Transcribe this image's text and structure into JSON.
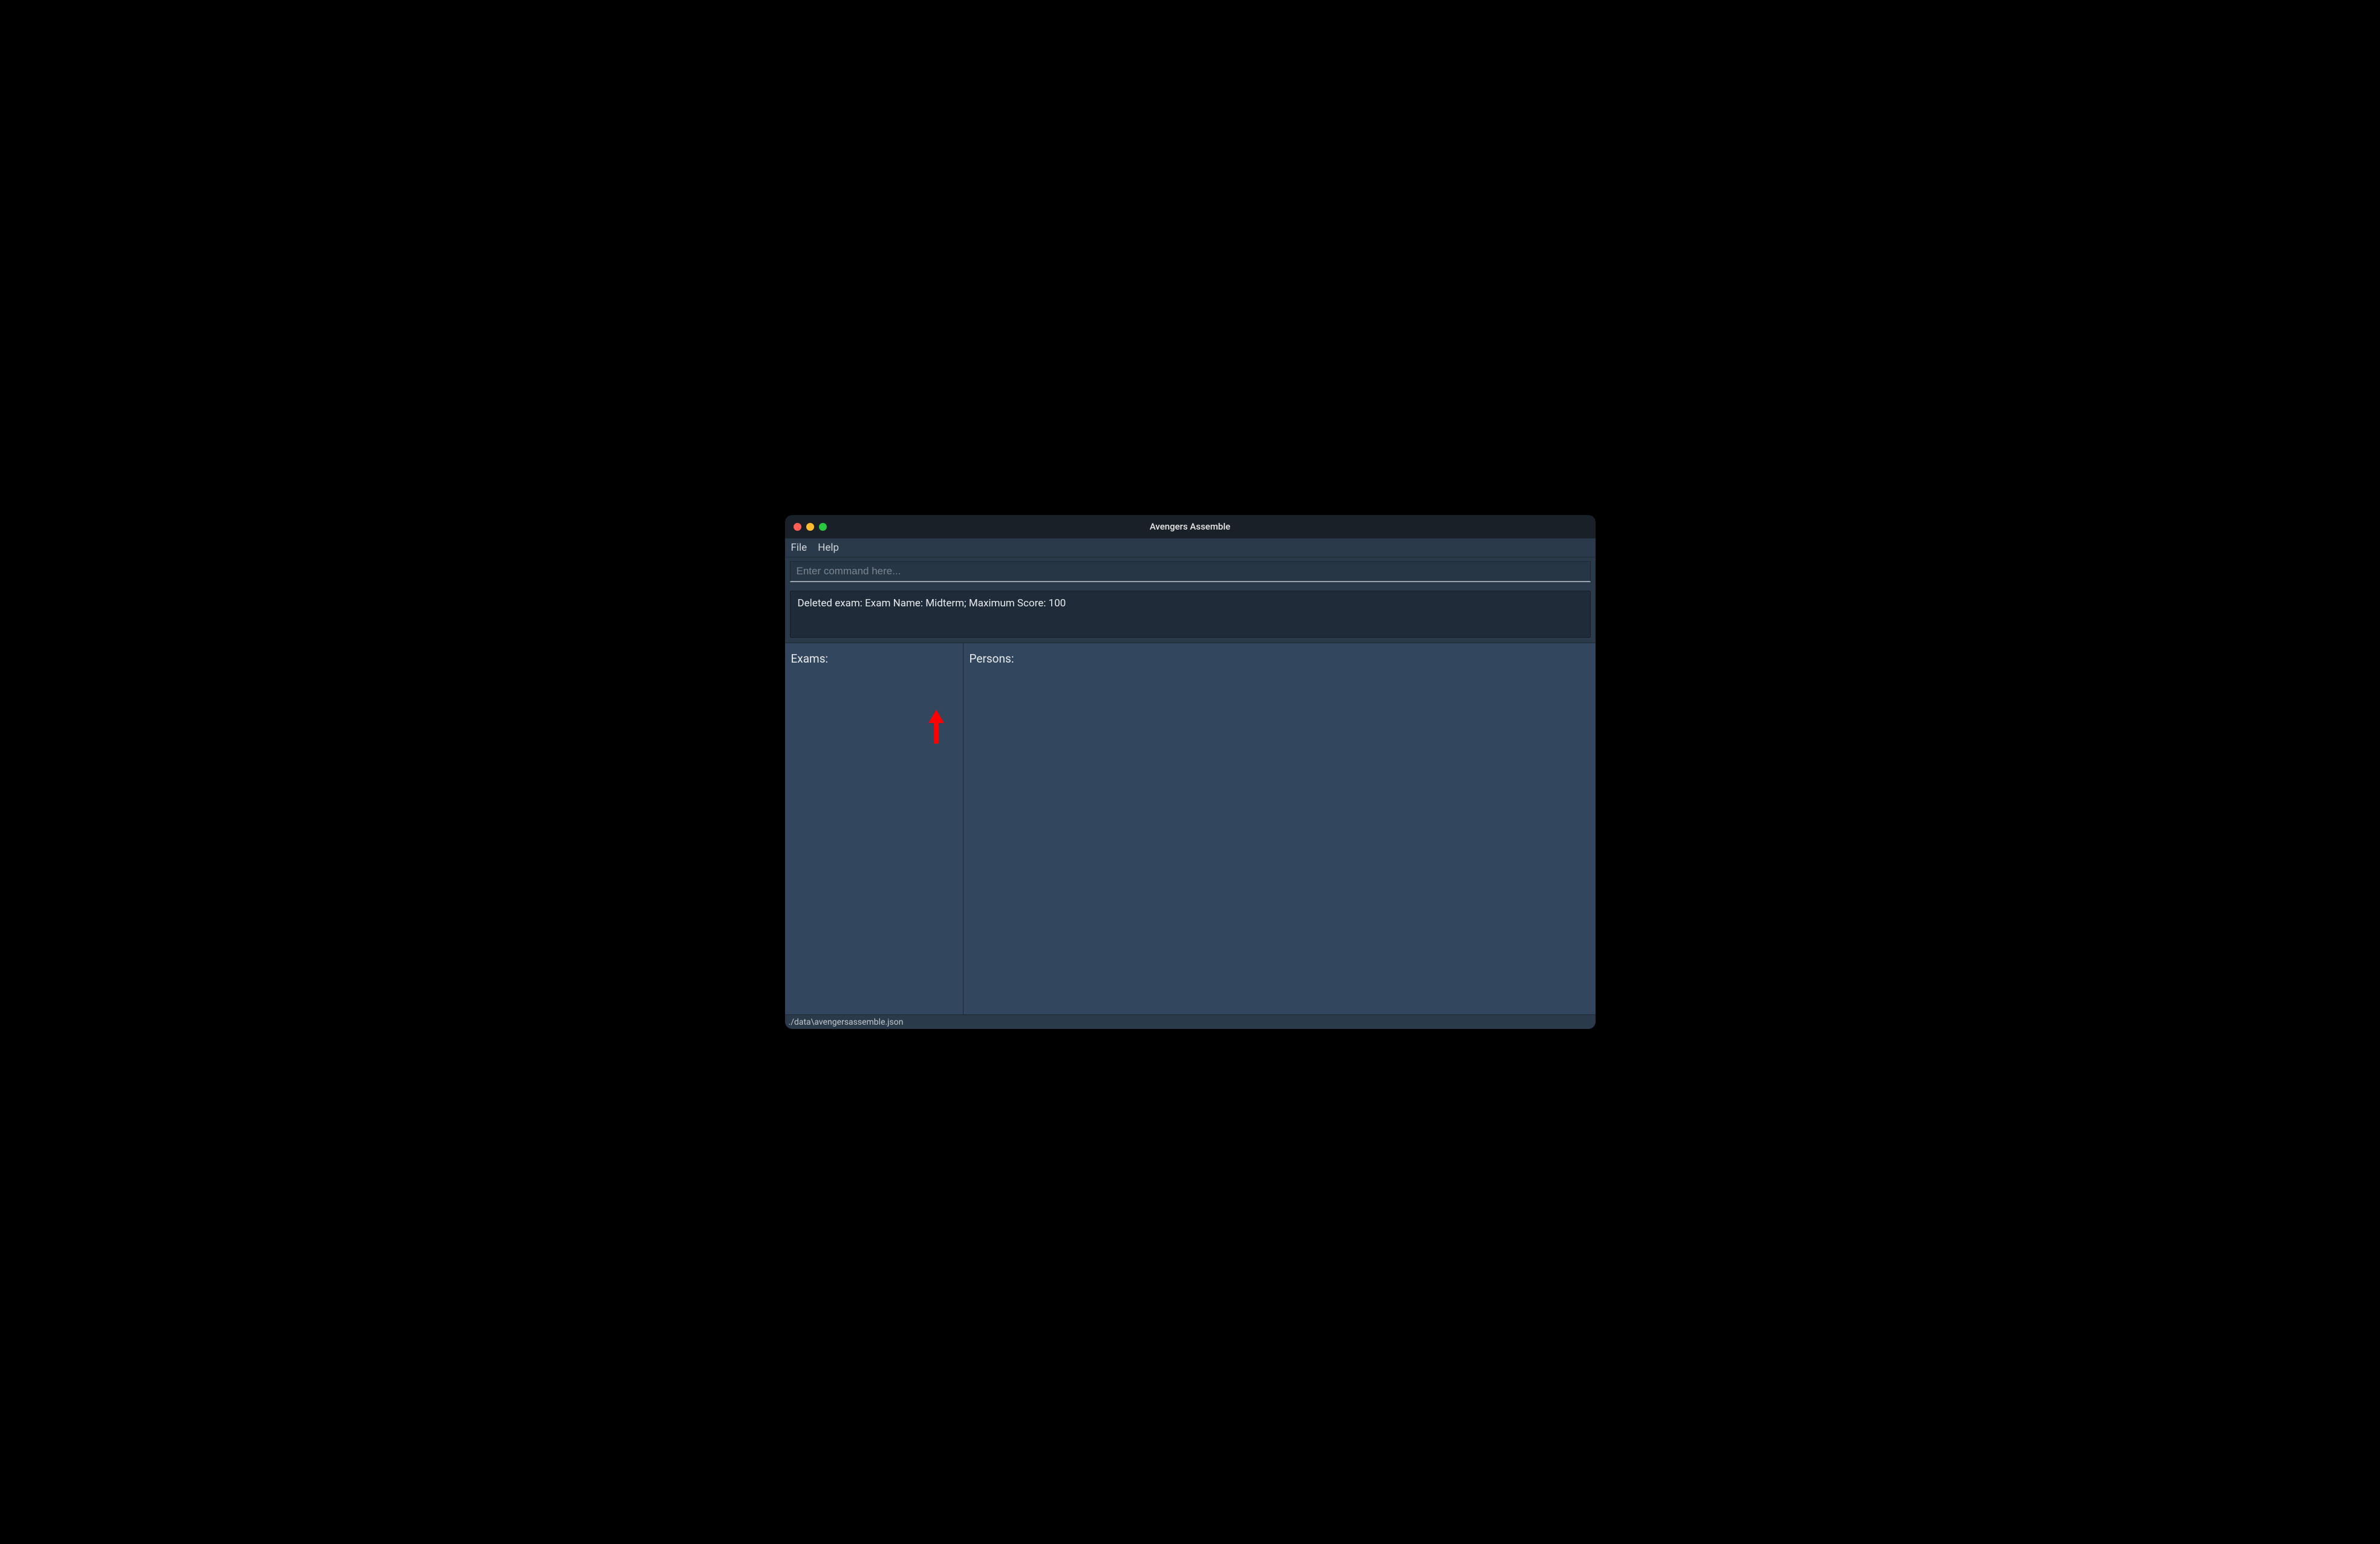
{
  "window": {
    "title": "Avengers Assemble"
  },
  "menubar": {
    "file": "File",
    "help": "Help"
  },
  "command": {
    "placeholder": "Enter command here..."
  },
  "status": {
    "message": "Deleted exam: Exam Name: Midterm; Maximum Score: 100"
  },
  "panels": {
    "exams_title": "Exams:",
    "persons_title": "Persons:"
  },
  "footer": {
    "path": "./data\\avengersassemble.json"
  },
  "annotation": {
    "arrow": "red-up-arrow"
  }
}
